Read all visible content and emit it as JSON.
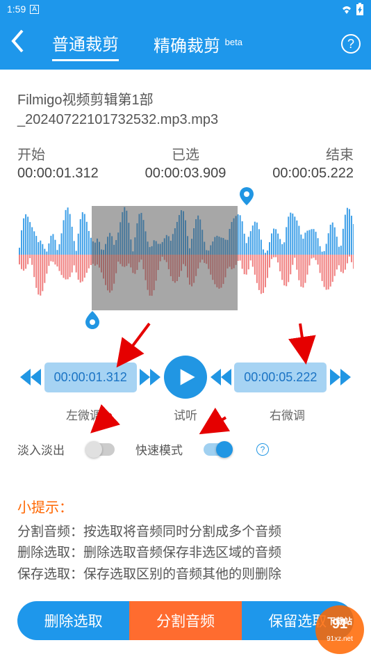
{
  "status": {
    "time": "1:59",
    "badge": "A"
  },
  "header": {
    "tab_normal": "普通裁剪",
    "tab_precise": "精确裁剪",
    "beta": "beta"
  },
  "file": {
    "line1": "Filmigo视频剪辑第1部",
    "line2": "_20240722101732532.mp3.mp3"
  },
  "times": {
    "start_label": "开始",
    "start_value": "00:00:01.312",
    "selected_label": "已选",
    "selected_value": "00:00:03.909",
    "end_label": "结束",
    "end_value": "00:00:05.222"
  },
  "controls": {
    "left_time": "00:00:01.312",
    "right_time": "00:00:05.222",
    "left_label": "左微调",
    "play_label": "试听",
    "right_label": "右微调"
  },
  "toggles": {
    "fade_label": "淡入淡出",
    "fast_label": "快速模式"
  },
  "tips": {
    "title": "小提示：",
    "line1": "分割音频：按选取将音频同时分割成多个音频",
    "line2": "删除选取：删除选取音频保存非选区域的音频",
    "line3": "保存选取：保存选取区别的音频其他的则删除"
  },
  "actions": {
    "delete": "删除选取",
    "split": "分割音频",
    "keep": "保留选取"
  },
  "watermark": {
    "top": "下载站",
    "bottom": "91xz.net"
  }
}
